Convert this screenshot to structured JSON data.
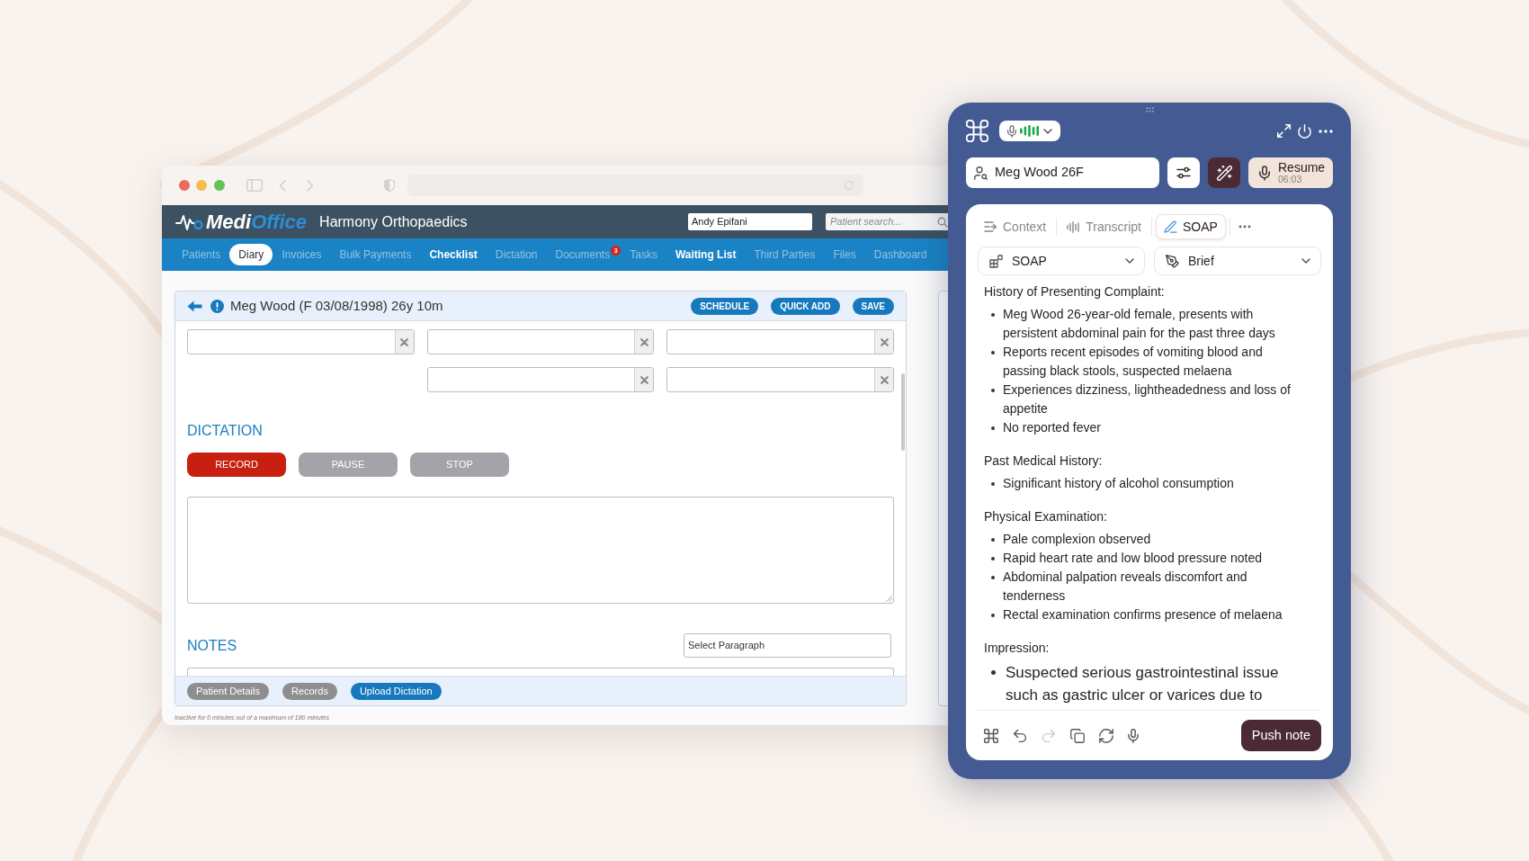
{
  "app": {
    "brand_main": "Medi",
    "brand_accent": "Office",
    "practice": "Harmony Orthopaedics",
    "user_field": {
      "value": "Andy Epifani"
    },
    "patient_search": {
      "placeholder": "Patient search..."
    }
  },
  "nav": [
    {
      "label": "Patients",
      "selected": false,
      "dimmed": true
    },
    {
      "label": "Diary",
      "selected": true,
      "dimmed": false
    },
    {
      "label": "Invoices",
      "selected": false,
      "dimmed": true
    },
    {
      "label": "Bulk Payments",
      "selected": false,
      "dimmed": true
    },
    {
      "label": "Checklist",
      "selected": false,
      "dimmed": false
    },
    {
      "label": "Dictation",
      "selected": false,
      "dimmed": true
    },
    {
      "label": "Documents",
      "selected": false,
      "dimmed": true,
      "badge": "3"
    },
    {
      "label": "Tasks",
      "selected": false,
      "dimmed": true
    },
    {
      "label": "Waiting List",
      "selected": false,
      "dimmed": false
    },
    {
      "label": "Third Parties",
      "selected": false,
      "dimmed": true
    },
    {
      "label": "Files",
      "selected": false,
      "dimmed": true
    },
    {
      "label": "Dashboard",
      "selected": false,
      "dimmed": true
    }
  ],
  "patient_card": {
    "title": "Meg Wood (F 03/08/1998) 26y 10m",
    "actions": [
      "SCHEDULE",
      "QUICK ADD",
      "SAVE"
    ],
    "dictation": {
      "heading": "DICTATION",
      "buttons": [
        {
          "label": "RECORD",
          "disabled": false
        },
        {
          "label": "PAUSE",
          "disabled": true
        },
        {
          "label": "STOP",
          "disabled": true
        }
      ]
    },
    "notes": {
      "heading": "NOTES",
      "paragraph_select": {
        "value": "Select Paragraph"
      }
    },
    "footer_buttons": [
      {
        "label": "Patient Details",
        "kind": "secondary"
      },
      {
        "label": "Records",
        "kind": "secondary"
      },
      {
        "label": "Upload Dictation",
        "kind": "primary"
      }
    ]
  },
  "inactivity_note": "Inactive for 0 minutes out of a maximum of 180 minutes",
  "assistant": {
    "patient_field": {
      "value": "Meg Wood 26F"
    },
    "resume": {
      "label": "Resume",
      "time": "06:03"
    },
    "tabs": [
      {
        "label": "Context",
        "kind": "context",
        "selected": false
      },
      {
        "label": "Transcript",
        "kind": "transcript",
        "selected": false
      },
      {
        "label": "SOAP",
        "kind": "note",
        "selected": true
      }
    ],
    "template_select": {
      "value": "SOAP"
    },
    "length_select": {
      "value": "Brief"
    },
    "sections": [
      {
        "heading": "History of Presenting Complaint:",
        "enlarged": false,
        "items": [
          "Meg Wood 26-year-old female, presents with persistent abdominal pain for the past three days",
          "Reports recent episodes of vomiting blood and passing black stools, suspected melaena",
          "Experiences dizziness, lightheadedness and loss of appetite",
          "No reported fever"
        ]
      },
      {
        "heading": "Past Medical History:",
        "enlarged": false,
        "items": [
          "Significant history of alcohol consumption"
        ]
      },
      {
        "heading": "Physical Examination:",
        "enlarged": false,
        "items": [
          "Pale complexion observed",
          "Rapid heart rate and low blood pressure noted",
          "Abdominal palpation reveals discomfort and tenderness",
          "Rectal examination confirms presence of melaena"
        ]
      },
      {
        "heading": "Impression:",
        "enlarged": true,
        "items": [
          "Suspected serious gastrointestinal issue such as gastric ulcer or varices due to"
        ]
      }
    ],
    "toolbar": [
      {
        "kind": "logo",
        "disabled": false
      },
      {
        "kind": "undo",
        "disabled": false
      },
      {
        "kind": "redo",
        "disabled": true
      },
      {
        "kind": "copy",
        "disabled": false
      },
      {
        "kind": "refresh",
        "disabled": false
      },
      {
        "kind": "mic",
        "disabled": false
      }
    ],
    "push_button": "Push note"
  }
}
